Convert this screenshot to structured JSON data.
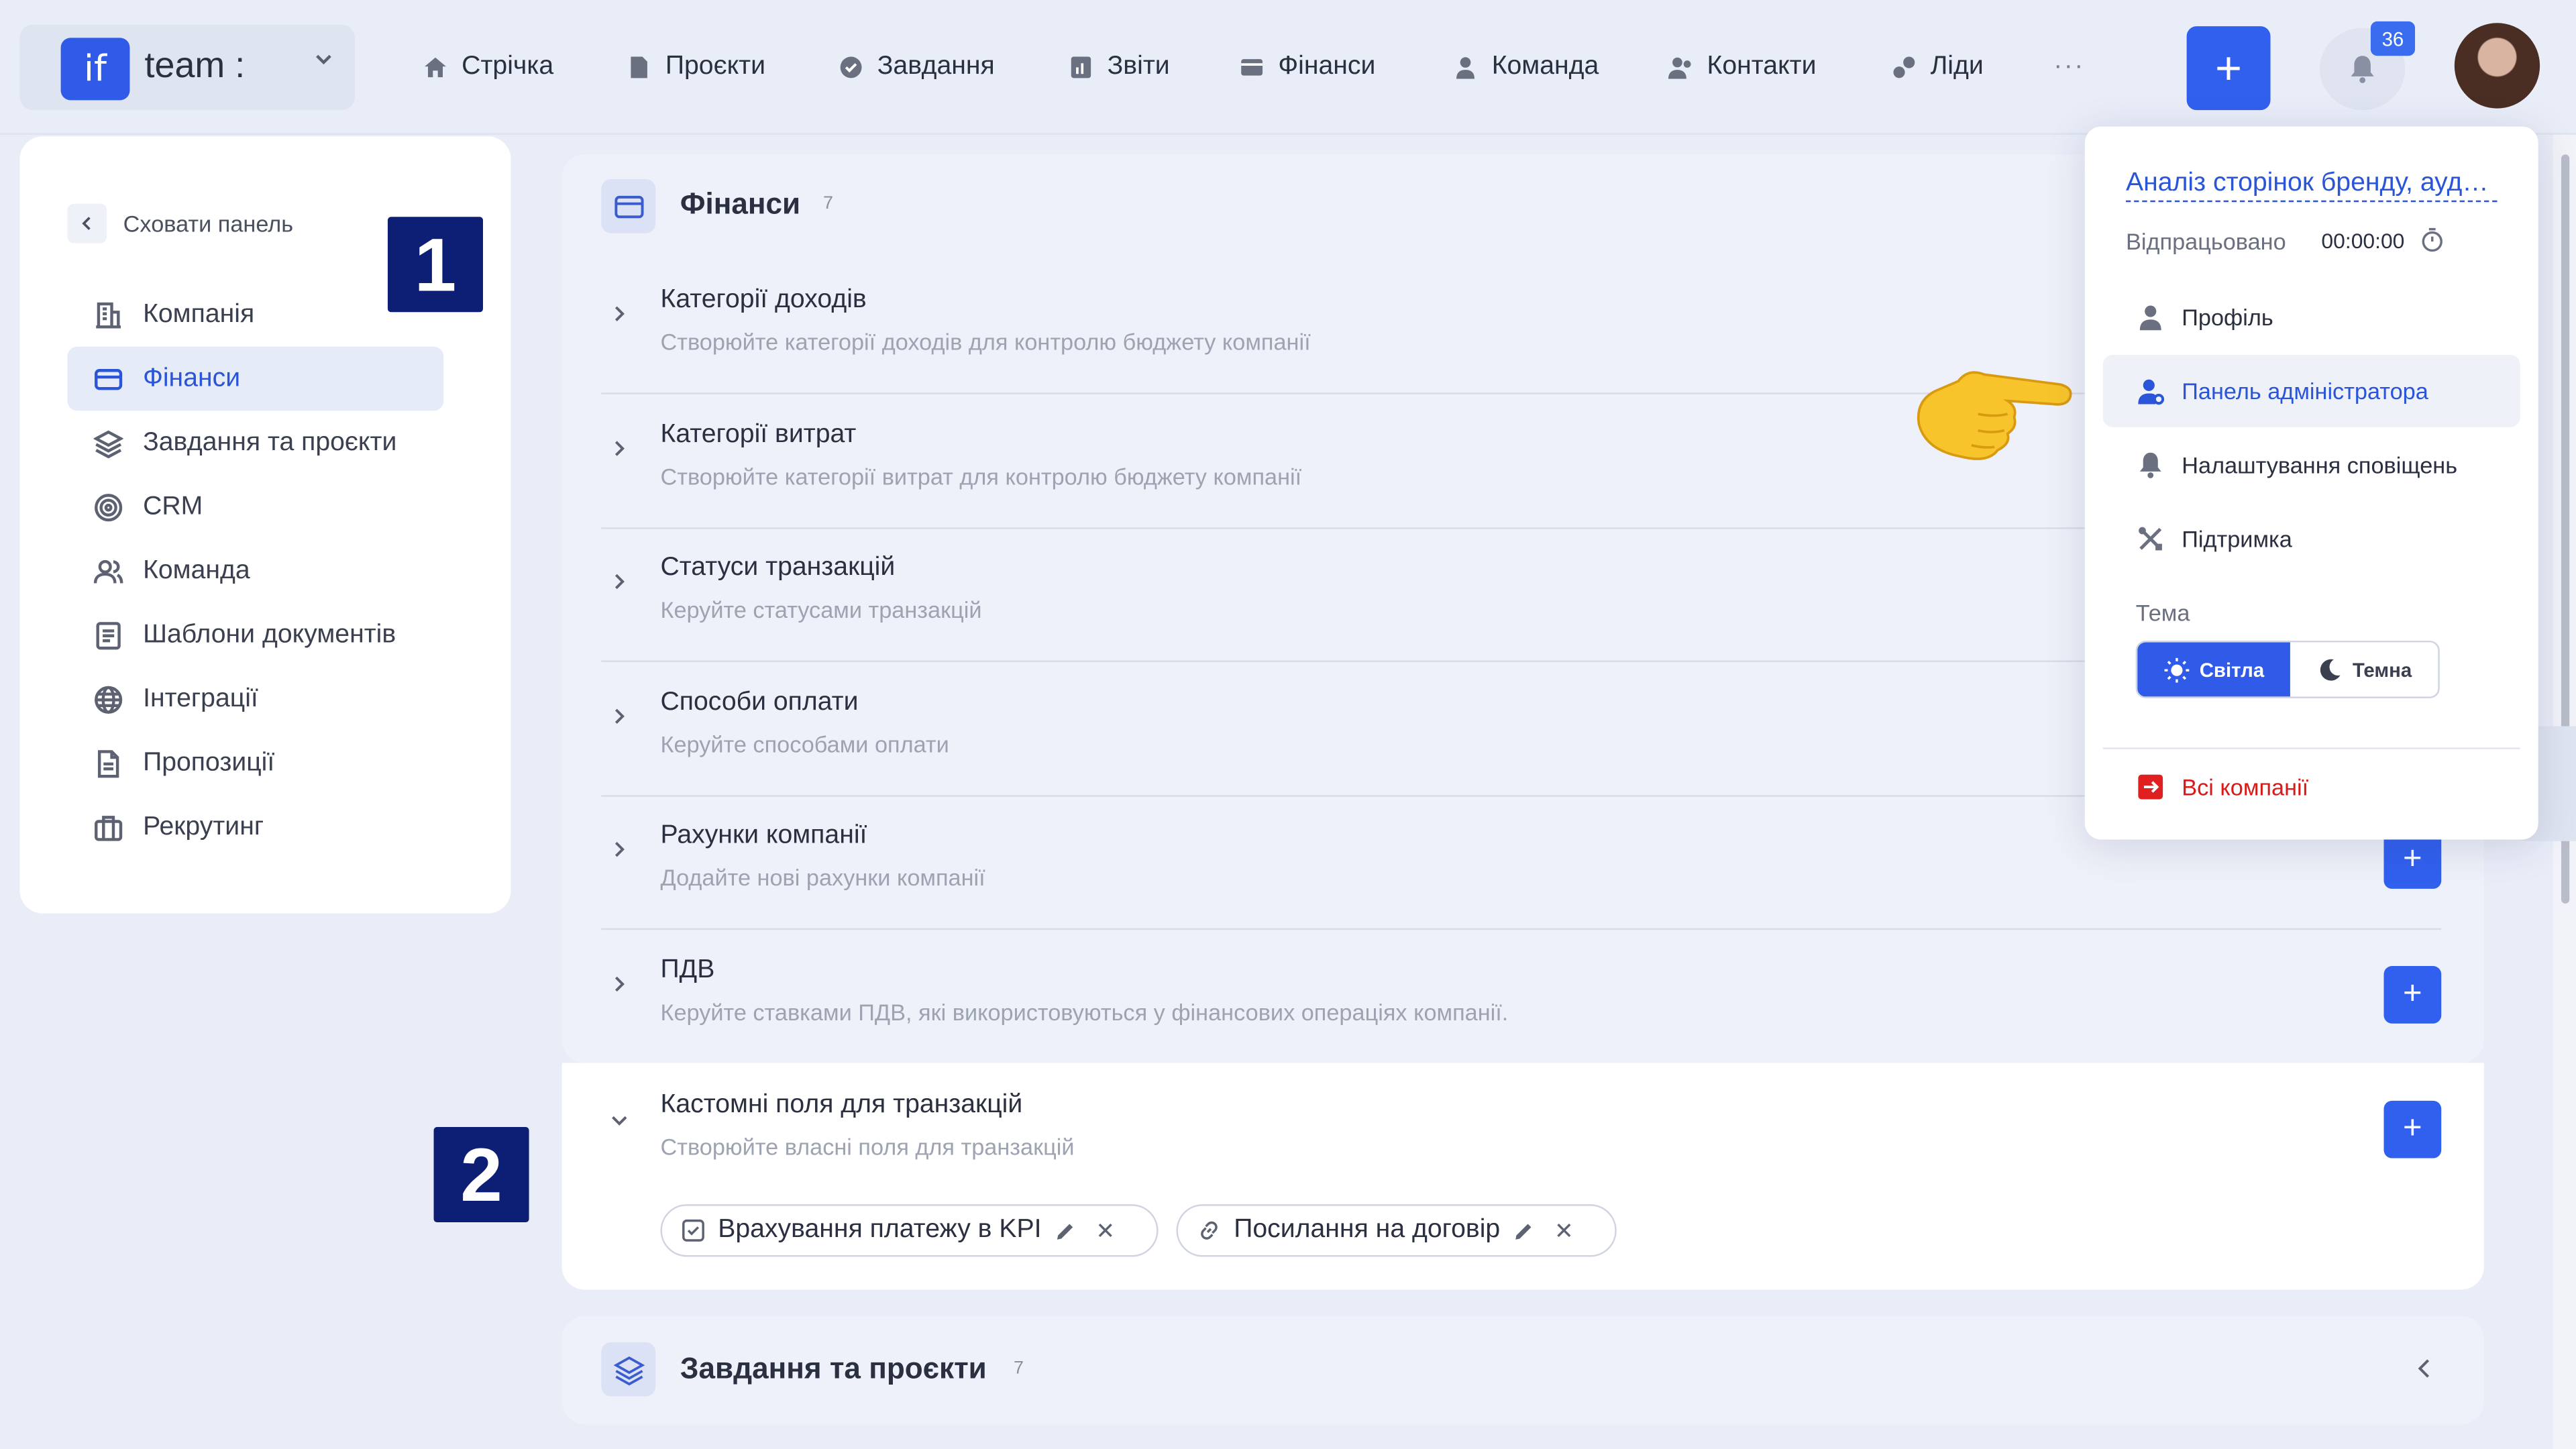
{
  "brand": {
    "logo": "if",
    "name": "team :"
  },
  "nav": [
    {
      "label": "Стрічка",
      "icon": "home-icon"
    },
    {
      "label": "Проєкти",
      "icon": "file-icon"
    },
    {
      "label": "Завдання",
      "icon": "check-circle-icon"
    },
    {
      "label": "Звіти",
      "icon": "report-icon"
    },
    {
      "label": "Фінанси",
      "icon": "wallet-icon"
    },
    {
      "label": "Команда",
      "icon": "user-icon"
    },
    {
      "label": "Контакти",
      "icon": "contacts-icon"
    },
    {
      "label": "Ліди",
      "icon": "leads-icon"
    }
  ],
  "nav_more": "···",
  "add_button": "+",
  "notifications": {
    "count": "36"
  },
  "sidebar": {
    "hide_label": "Сховати панель",
    "items": [
      {
        "label": "Компанія",
        "icon": "company-icon"
      },
      {
        "label": "Фінанси",
        "icon": "card-icon",
        "active": true
      },
      {
        "label": "Завдання та проєкти",
        "icon": "layers-icon"
      },
      {
        "label": "CRM",
        "icon": "target-icon"
      },
      {
        "label": "Команда",
        "icon": "team-icon"
      },
      {
        "label": "Шаблони документів",
        "icon": "document-icon"
      },
      {
        "label": "Інтеграції",
        "icon": "globe-icon"
      },
      {
        "label": "Пропозиції",
        "icon": "proposal-icon"
      },
      {
        "label": "Рекрутинг",
        "icon": "briefcase-icon"
      }
    ]
  },
  "markers": {
    "one": "1",
    "two": "2"
  },
  "finance": {
    "title": "Фінанси",
    "count": "7",
    "rows": [
      {
        "title": "Категорії доходів",
        "desc": "Створюйте категорії доходів для контролю бюджету компанії"
      },
      {
        "title": "Категорії витрат",
        "desc": "Створюйте категорії витрат для контролю бюджету компанії"
      },
      {
        "title": "Статуси транзакцій",
        "desc": "Керуйте статусами транзакцій"
      },
      {
        "title": "Способи оплати",
        "desc": "Керуйте способами оплати"
      },
      {
        "title": "Рахунки компанії",
        "desc": "Додайте нові рахунки компанії"
      },
      {
        "title": "ПДВ",
        "desc": "Керуйте ставками ПДВ, які використовуються у фінансових операціях компанії."
      }
    ],
    "custom": {
      "title": "Кастомні поля для транзакцій",
      "desc": "Створюйте власні поля для транзакцій",
      "chips": [
        "Врахування платежу в KPI",
        "Посилання на договір"
      ]
    }
  },
  "tasks": {
    "title": "Завдання та проєкти",
    "count": "7"
  },
  "dropdown": {
    "task_link": "Аналіз сторінок бренду, аудит контенту",
    "worked_label": "Відпрацьовано",
    "worked_value": "00:00:00",
    "items": [
      {
        "label": "Профіль",
        "icon": "profile-icon"
      },
      {
        "label": "Панель адміністратора",
        "icon": "admin-icon"
      },
      {
        "label": "Налаштування сповіщень",
        "icon": "bell-icon"
      },
      {
        "label": "Підтримка",
        "icon": "tools-icon"
      }
    ],
    "theme_label": "Тема",
    "theme_light": "Світла",
    "theme_dark": "Темна",
    "all_companies": "Всі компанії"
  },
  "colors": {
    "accent": "#3160ee",
    "badge": "#0d1f75",
    "danger": "#d71a1a"
  }
}
